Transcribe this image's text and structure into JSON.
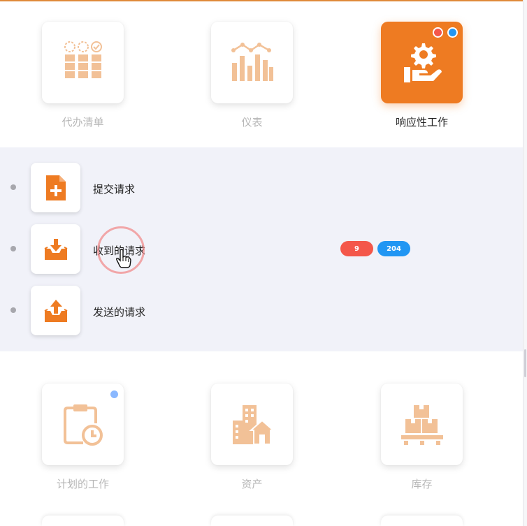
{
  "top_tiles": [
    {
      "label": "代办清单",
      "icon": "todo-list-icon",
      "active": false
    },
    {
      "label": "仪表",
      "icon": "dashboard-chart-icon",
      "active": false
    },
    {
      "label": "响应性工作",
      "icon": "responsive-work-icon",
      "active": true
    }
  ],
  "submenu": {
    "items": [
      {
        "label": "提交请求",
        "icon": "submit-document-icon"
      },
      {
        "label": "收到的请求",
        "icon": "inbox-download-icon"
      },
      {
        "label": "发送的请求",
        "icon": "outbox-upload-icon"
      }
    ],
    "badges": {
      "red": "9",
      "blue": "204"
    }
  },
  "bottom_tiles": [
    {
      "label": "计划的工作",
      "icon": "planned-work-clipboard-icon"
    },
    {
      "label": "资产",
      "icon": "assets-buildings-icon"
    },
    {
      "label": "库存",
      "icon": "inventory-boxes-icon"
    }
  ],
  "colors": {
    "accent": "#ee7b22",
    "icon_muted": "#f2c197",
    "badge_red": "#f4574a",
    "badge_blue": "#2196f3",
    "submenu_bg": "#f1f2f9"
  }
}
